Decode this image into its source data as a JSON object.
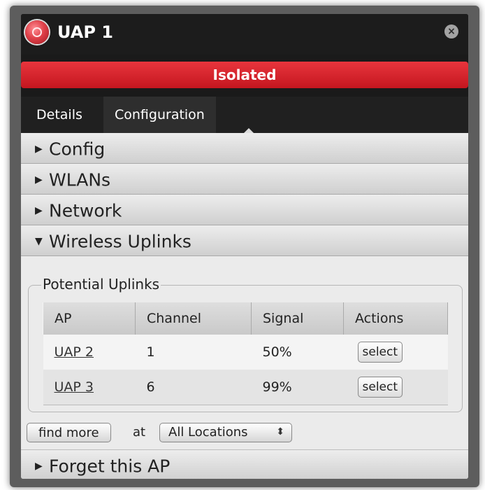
{
  "window": {
    "title": "UAP 1",
    "close_icon": "close-icon",
    "status_icon": "status-dot-icon"
  },
  "status": {
    "text": "Isolated",
    "color": "#d42029"
  },
  "tabs": [
    {
      "label": "Details",
      "active": false
    },
    {
      "label": "Configuration",
      "active": true
    }
  ],
  "sections": {
    "config": {
      "label": "Config",
      "expanded": false
    },
    "wlans": {
      "label": "WLANs",
      "expanded": false
    },
    "network": {
      "label": "Network",
      "expanded": false
    },
    "wireless_uplinks": {
      "label": "Wireless Uplinks",
      "expanded": true
    },
    "forget": {
      "label": "Forget this AP",
      "expanded": false
    }
  },
  "uplinks": {
    "legend": "Potential Uplinks",
    "columns": [
      "AP",
      "Channel",
      "Signal",
      "Actions"
    ],
    "rows": [
      {
        "ap": "UAP 2",
        "channel": "1",
        "signal": "50%",
        "action": "select"
      },
      {
        "ap": "UAP 3",
        "channel": "6",
        "signal": "99%",
        "action": "select"
      }
    ]
  },
  "find": {
    "button_label": "find more",
    "at_label": "at",
    "location_selected": "All Locations"
  }
}
